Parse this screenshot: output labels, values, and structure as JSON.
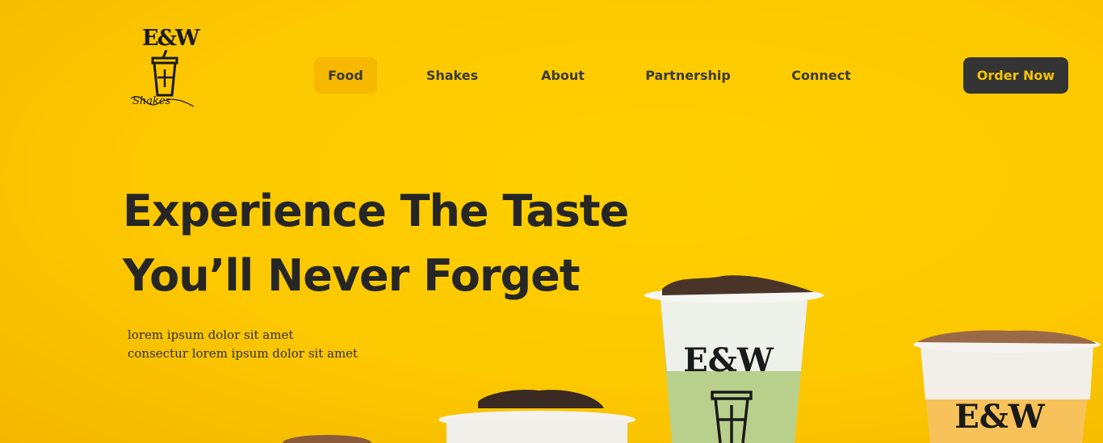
{
  "logo": {
    "monogram": "E&W",
    "script": "Shakes"
  },
  "nav": {
    "items": [
      {
        "label": "Food",
        "active": true
      },
      {
        "label": "Shakes",
        "active": false
      },
      {
        "label": "About",
        "active": false
      },
      {
        "label": "Partnership",
        "active": false
      },
      {
        "label": "Connect",
        "active": false
      }
    ]
  },
  "cta": {
    "label": "Order Now"
  },
  "hero": {
    "headline_line1": "Experience The Taste",
    "headline_line2": "You’ll Never Forget",
    "sub_line1": "lorem ipsum dolor sit amet",
    "sub_line2": "consectur lorem ipsum dolor sit amet"
  },
  "cup_brand": "E&W",
  "colors": {
    "background": "#fcc800",
    "accent": "#f7b800",
    "button": "#343434",
    "button_text": "#f5c400"
  }
}
